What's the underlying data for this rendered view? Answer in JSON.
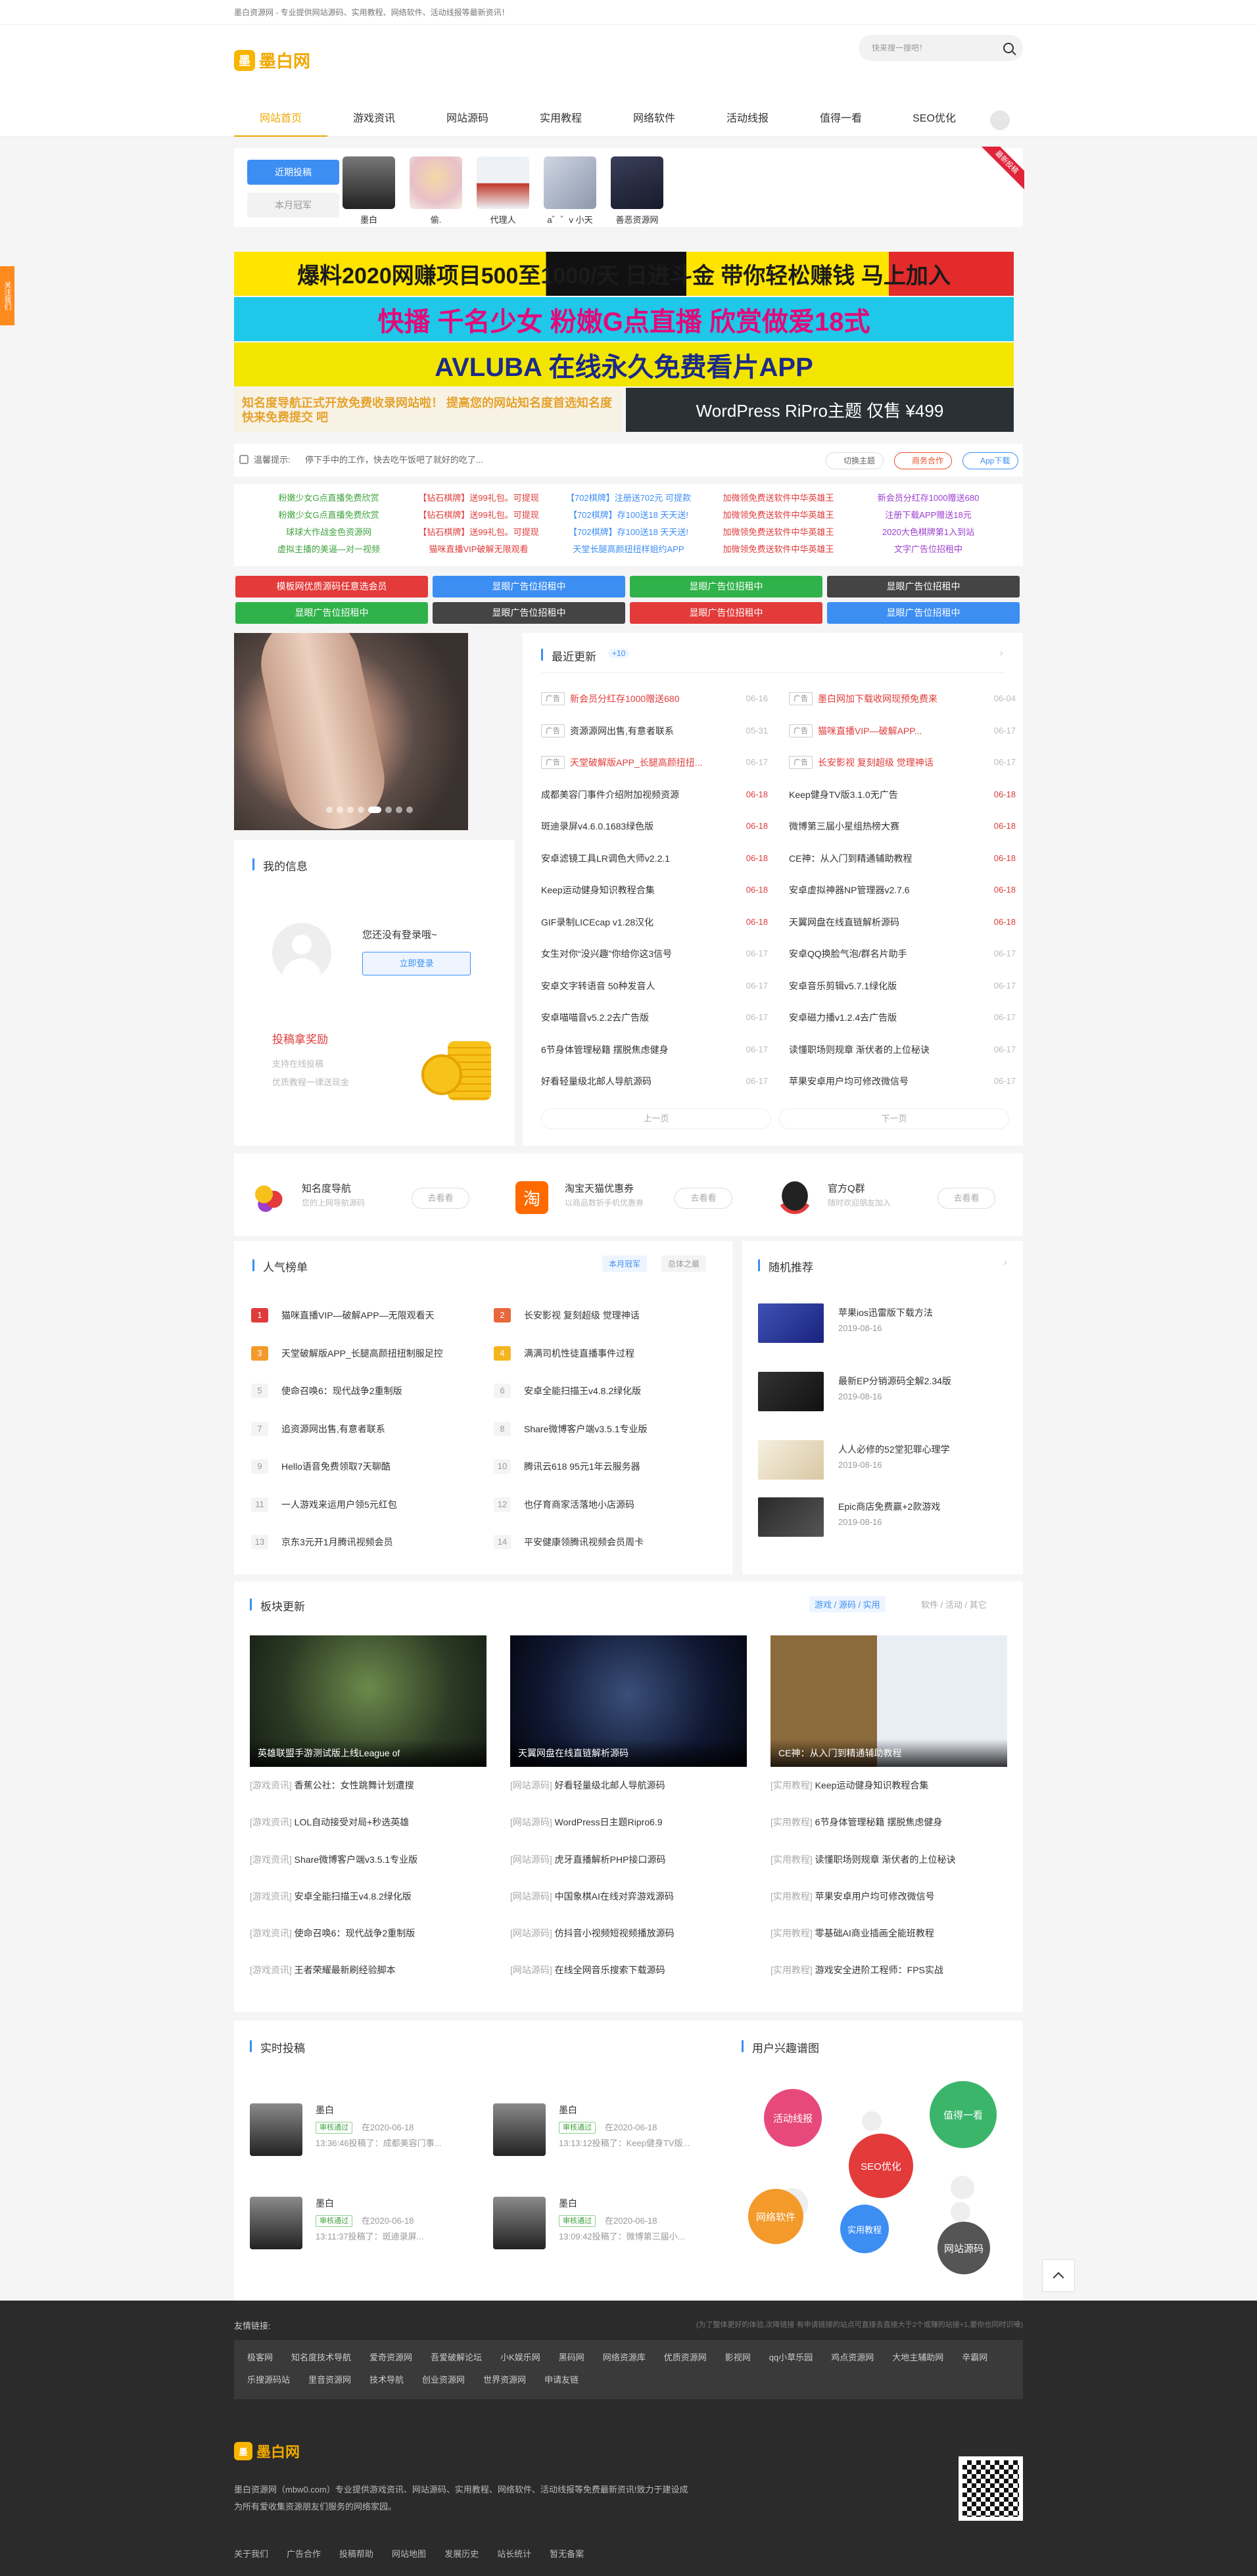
{
  "topbar": {
    "tagline": "墨白资源网 - 专业提供网站源码、实用教程、网络软件、活动线报等最新资讯！"
  },
  "header": {
    "logo_text": "墨白网",
    "search_placeholder": "快来搜一搜吧！"
  },
  "nav": [
    "网站首页",
    "游戏资讯",
    "网站源码",
    "实用教程",
    "网络软件",
    "活动线报",
    "值得一看",
    "SEO优化"
  ],
  "contributors": {
    "tabs": [
      "近期投稿",
      "本月冠军"
    ],
    "users": [
      "墨白",
      "偷.",
      "代理人",
      "a゛゛v 小天",
      "善恶资源网"
    ],
    "ribbon": "最新投稿"
  },
  "banners": [
    {
      "text": "爆料2020网赚项目500至1000/天 日进斗金 带你轻松赚钱 马上加入",
      "bg": "#111",
      "fg": "#f5e400"
    },
    {
      "text": "快播 千名少女 粉嫩G点直播 欣赏做爱18式",
      "bg": "#1fc7e8",
      "fg": "#e20a7a"
    },
    {
      "text": "AVLUBA 在线永久免费看片APP",
      "bg": "#f2e600",
      "fg": "#1b2a8a"
    },
    {
      "text": "知名度导航正式开放免费收录网站啦！ 提高您的网站知名度首选知名度 快来免费提交 吧",
      "bg": "#f7f2e4",
      "fg": "#e6a22c"
    },
    {
      "text": "WordPress RiPro主题 仅售 ¥499",
      "bg": "#2a3134",
      "fg": "#ffffff"
    }
  ],
  "notice": {
    "label": "温馨提示:",
    "text": "停下手中的工作，快去吃午饭吧了就好的吃了...",
    "buttons": [
      "切换主题",
      "商务合作",
      "App下载"
    ]
  },
  "links_rows": [
    [
      "粉嫩少女G点直播免费欣赏",
      "【钻石棋牌】送99礼包。可提现",
      "【702棋牌】注册送702元 可提款",
      "加微领免费送软件中华英雄王",
      "新会员分红存1000赠送680"
    ],
    [
      "粉嫩少女G点直播免费欣赏",
      "【钻石棋牌】送99礼包。可提现",
      "【702棋牌】存100送18 天天送!",
      "加微领免费送软件中华英雄王",
      "注册下载APP赠送18元"
    ],
    [
      "球球大作战金色资源网",
      "【钻石棋牌】送99礼包。可提现",
      "【702棋牌】存100送18 天天送!",
      "加微领免费送软件中华英雄王",
      "2020大色棋牌第1入到站"
    ],
    [
      "虚拟主播的美逼—对一视频",
      "猫咪直播VIP破解无限观看",
      "天堂长腿高颜扭扭样姐约APP",
      "加微领免费送软件中华英雄王",
      "文字广告位招租中"
    ]
  ],
  "ad_buttons": [
    {
      "label": "模板网优质源码任意选会员",
      "color": "#e33a3a"
    },
    {
      "label": "显眼广告位招租中",
      "color": "#3c8ef3"
    },
    {
      "label": "显眼广告位招租中",
      "color": "#2fb24a"
    },
    {
      "label": "显眼广告位招租中",
      "color": "#444444"
    },
    {
      "label": "显眼广告位招租中",
      "color": "#2fb24a"
    },
    {
      "label": "显眼广告位招租中",
      "color": "#444444"
    },
    {
      "label": "显眼广告位招租中",
      "color": "#e33a3a"
    },
    {
      "label": "显眼广告位招租中",
      "color": "#3c8ef3"
    }
  ],
  "myinfo": {
    "title": "我的信息",
    "not_logged": "您还没有登录哦~",
    "login": "立即登录",
    "contrib_title": "投稿拿奖励",
    "contrib_l1": "支持在线投稿",
    "contrib_l2": "优质教程一律送现金"
  },
  "latest": {
    "title": "最近更新",
    "count": "+10",
    "left": [
      {
        "tag": "广告",
        "t": "新会员分红存1000赠送680",
        "d": "06-16",
        "red": true
      },
      {
        "tag": "广告",
        "t": "资源源网出售,有意者联系",
        "d": "05-31",
        "red": false
      },
      {
        "tag": "广告",
        "t": "天堂破解版APP_长腿高颜扭扭...",
        "d": "06-17",
        "red": true
      },
      {
        "tag": "",
        "t": "成都美容门事件介绍附加视频资源",
        "d": "06-18",
        "red": false
      },
      {
        "tag": "",
        "t": "斑迪录屏v4.6.0.1683绿色版",
        "d": "06-18",
        "red": false
      },
      {
        "tag": "",
        "t": "安卓滤镜工具LR调色大师v2.2.1",
        "d": "06-18",
        "red": false
      },
      {
        "tag": "",
        "t": "Keep运动健身知识教程合集",
        "d": "06-18",
        "red": false
      },
      {
        "tag": "",
        "t": "GIF录制LICEcap v1.28汉化",
        "d": "06-18",
        "red": false
      },
      {
        "tag": "",
        "t": "女生对你“没兴趣”你给你这3信号",
        "d": "06-17",
        "red": false
      },
      {
        "tag": "",
        "t": "安卓文字转语音 50种发音人",
        "d": "06-17",
        "red": false
      },
      {
        "tag": "",
        "t": "安卓喵喵音v5.2.2去广告版",
        "d": "06-17",
        "red": false
      },
      {
        "tag": "",
        "t": "6节身体管理秘籍 摆脱焦虑健身",
        "d": "06-17",
        "red": false
      },
      {
        "tag": "",
        "t": "好看轻量级北邮人导航源码",
        "d": "06-17",
        "red": false
      }
    ],
    "right": [
      {
        "tag": "广告",
        "t": "墨白网加下载收网现预免费来",
        "d": "06-04",
        "red": true
      },
      {
        "tag": "广告",
        "t": "猫咪直播VIP—破解APP...",
        "d": "06-17",
        "red": true
      },
      {
        "tag": "广告",
        "t": "长安影视 复刻超级 觉理神话",
        "d": "06-17",
        "red": true
      },
      {
        "tag": "",
        "t": "Keep健身TV版3.1.0无广告",
        "d": "06-18",
        "red": false
      },
      {
        "tag": "",
        "t": "微博第三届小星组热榜大赛",
        "d": "06-18",
        "red": false
      },
      {
        "tag": "",
        "t": "CE神：从入门到精通辅助教程",
        "d": "06-18",
        "red": false
      },
      {
        "tag": "",
        "t": "安卓虚拟神器NP管理器v2.7.6",
        "d": "06-18",
        "red": false
      },
      {
        "tag": "",
        "t": "天翼网盘在线直链解析源码",
        "d": "06-18",
        "red": false
      },
      {
        "tag": "",
        "t": "安卓QQ换脸气泡/群名片助手",
        "d": "06-17",
        "red": false
      },
      {
        "tag": "",
        "t": "安卓音乐剪辑v5.7.1绿化版",
        "d": "06-17",
        "red": false
      },
      {
        "tag": "",
        "t": "安卓磁力播v1.2.4去广告版",
        "d": "06-17",
        "red": false
      },
      {
        "tag": "",
        "t": "读懂职场则规章 渐伏者的上位秘诀",
        "d": "06-17",
        "red": false
      },
      {
        "tag": "",
        "t": "苹果安卓用户均可修改微信号",
        "d": "06-17",
        "red": false
      }
    ],
    "prev": "上一页",
    "next": "下一页"
  },
  "features": [
    {
      "name": "知名度导航",
      "sub": "您的上网导航源码",
      "btn": "去看看",
      "color": "#f08c2a"
    },
    {
      "name": "淘宝天猫优惠券",
      "sub": "以商品数折手机优惠券",
      "btn": "去看看",
      "color": "#ff6a00"
    },
    {
      "name": "官方Q群",
      "sub": "随时欢迎朋友加入",
      "btn": "去看看",
      "color": "#222222"
    }
  ],
  "ranking": {
    "title": "人气榜单",
    "tabs": [
      "本月冠军",
      "总体之最"
    ],
    "items": [
      "猫咪直播VIP—破解APP—无限观看天",
      "长安影视 复刻超级 觉理神话",
      "天堂破解版APP_长腿高颜扭扭制服足控",
      "满满司机性徒直播事件过程",
      "使命召唤6：现代战争2重制版",
      "安卓全能扫描王v4.8.2绿化版",
      "追资源网出售,有意者联系",
      "Share微博客户端v3.5.1专业版",
      "Hello语音免费领取7天聊酷",
      "腾讯云618 95元1年云服务器",
      "一人游戏来运用户领5元红包",
      "也仔育商家活落地小店源码",
      "京东3元开1月腾讯视频会员",
      "平安健康领腾讯视频会员周卡"
    ]
  },
  "random": {
    "title": "随机推荐",
    "items": [
      {
        "t": "苹果ios迅雷版下载方法",
        "d": "2019-08-16"
      },
      {
        "t": "最新EP分销源码全解2.34版",
        "d": "2019-08-16"
      },
      {
        "t": "人人必修的52堂犯罪心理学",
        "d": "2019-08-16"
      },
      {
        "t": "Epic商店免费赢+2款游戏",
        "d": "2019-08-16"
      }
    ]
  },
  "blocks": {
    "title": "板块更新",
    "tabs_left": "游戏 / 源码 / 实用",
    "tabs_right": "软件 / 活动 / 其它",
    "cols": [
      {
        "cap": "英雄联盟手游测试版上线League of",
        "items": [
          [
            "[游戏资讯]",
            "香蕉公社：女性跳舞计划遭搜"
          ],
          [
            "[游戏资讯]",
            "LOL自动接受对局+秒选英雄"
          ],
          [
            "[游戏资讯]",
            "Share微博客户端v3.5.1专业版"
          ],
          [
            "[游戏资讯]",
            "安卓全能扫描王v4.8.2绿化版"
          ],
          [
            "[游戏资讯]",
            "使命召唤6：现代战争2重制版"
          ],
          [
            "[游戏资讯]",
            "王者荣耀最新刷经验脚本"
          ]
        ]
      },
      {
        "cap": "天翼网盘在线直链解析源码",
        "items": [
          [
            "[网站源码]",
            "好看轻量级北邮人导航源码"
          ],
          [
            "[网站源码]",
            "WordPress日主题Ripro6.9"
          ],
          [
            "[网站源码]",
            "虎牙直播解析PHP接口源码"
          ],
          [
            "[网站源码]",
            "中国象棋AI在线对弈游戏源码"
          ],
          [
            "[网站源码]",
            "仿抖音小视频短视频播放源码"
          ],
          [
            "[网站源码]",
            "在线全网音乐搜索下载源码"
          ]
        ]
      },
      {
        "cap": "CE神：从入门到精通辅助教程",
        "items": [
          [
            "[实用教程]",
            "Keep运动健身知识教程合集"
          ],
          [
            "[实用教程]",
            "6节身体管理秘籍 摆脱焦虑健身"
          ],
          [
            "[实用教程]",
            "读懂职场则规章 渐伏者的上位秘诀"
          ],
          [
            "[实用教程]",
            "苹果安卓用户均可修改微信号"
          ],
          [
            "[实用教程]",
            "零基础AI商业插画全能班教程"
          ],
          [
            "[实用教程]",
            "游戏安全进阶工程师：FPS实战"
          ]
        ]
      }
    ]
  },
  "live": {
    "title": "实时投稿",
    "items": [
      {
        "nm": "墨白",
        "bd": "审核通过",
        "dt": "在2020-06-18",
        "ex": "13:36:46投稿了：成都美容门事..."
      },
      {
        "nm": "墨白",
        "bd": "审核通过",
        "dt": "在2020-06-18",
        "ex": "13:13:12投稿了：Keep健身TV版..."
      },
      {
        "nm": "墨白",
        "bd": "审核通过",
        "dt": "在2020-06-18",
        "ex": "13:11:37投稿了：斑迪录屏..."
      },
      {
        "nm": "墨白",
        "bd": "审核通过",
        "dt": "在2020-06-18",
        "ex": "13:09:42投稿了：微博第三届小..."
      }
    ]
  },
  "interests": {
    "title": "用户兴趣谱图",
    "bubbles": [
      {
        "label": "活动线报",
        "color": "#e8497c"
      },
      {
        "label": "值得一看",
        "color": "#3ab56a"
      },
      {
        "label": "SEO优化",
        "color": "#e33a3a"
      },
      {
        "label": "网络软件",
        "color": "#f39a2b"
      },
      {
        "label": "实用教程",
        "color": "#3c8ef3"
      },
      {
        "label": "网站源码",
        "color": "#555555"
      }
    ]
  },
  "footer": {
    "links_title": "友情链接:",
    "links_note": "(为了整体更好的体验,次降链接 有申请链接的站点可直接去直接大于2个或赚的站接+1,要你也同时识嗓)",
    "links": [
      "极客网",
      "知名度技术导航",
      "爱奇资源网",
      "吾爱破解论坛",
      "小K娱乐网",
      "黑码网",
      "网络资源库",
      "优质资源网",
      "影视网",
      "qq小草乐园",
      "鸡点资源网",
      "大地主辅助网",
      "辛霸网",
      "乐搜源码站",
      "里音资源网",
      "技术导航",
      "创业资源网",
      "世界资源网",
      "申请友链"
    ],
    "logo_text": "墨白网",
    "about": "墨白资源网（mbw0.com）专业提供游戏资讯、网站源码、实用教程、网络软件、活动线报等免费最新资讯!致力于建设成为所有爱收集资源朋友们服务的网络家园。",
    "nav": [
      "关于我们",
      "广告合作",
      "投稿帮助",
      "网站地图",
      "发展历史",
      "站长统计",
      "暂无备案"
    ]
  },
  "side_tab": "关注我们"
}
